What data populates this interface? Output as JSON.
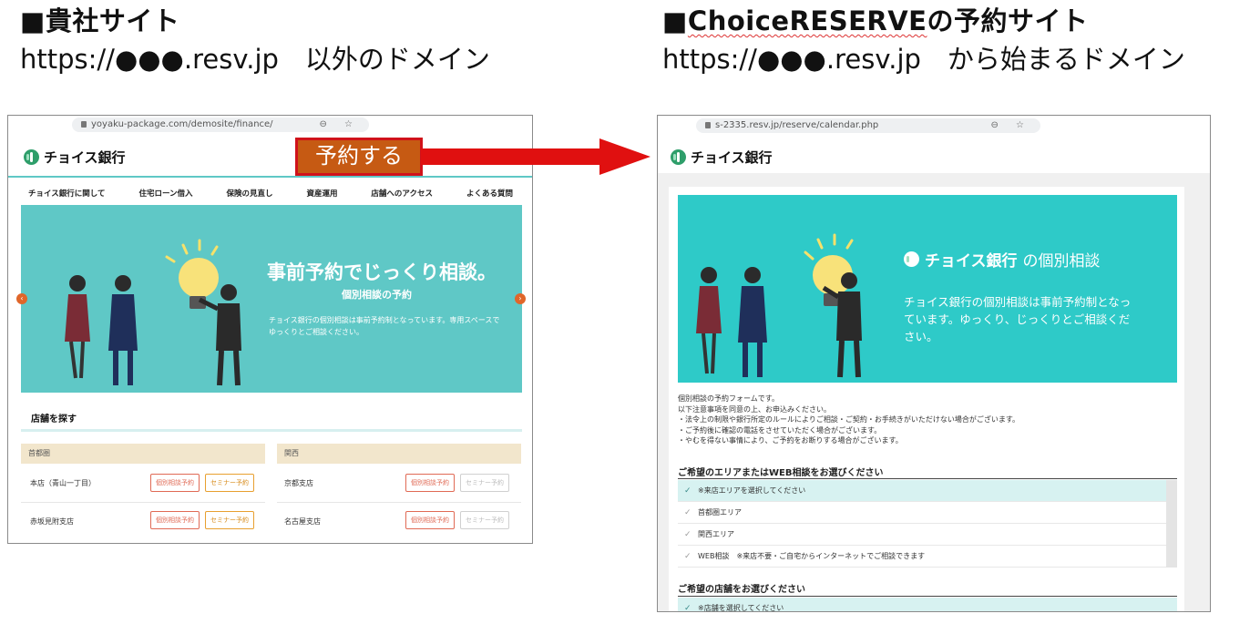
{
  "left": {
    "heading": "■貴社サイト",
    "url_caption": "https://●●●.resv.jp　以外のドメイン",
    "browser": {
      "address": "yoyaku-package.com/demosite/finance/",
      "tools": "⊖ ☆"
    },
    "logo_text": "チョイス銀行",
    "reserve_button": "予約する",
    "nav": [
      "チョイス銀行に関して",
      "住宅ローン借入",
      "保険の見直し",
      "資産運用",
      "店舗へのアクセス",
      "よくある質問"
    ],
    "hero": {
      "title": "事前予約でじっくり相談。",
      "subtitle": "個別相談の予約",
      "text": "チョイス銀行の個別相談は事前予約制となっています。専用スペースでゆっくりとご相談ください。"
    },
    "store_search": "店舗を探す",
    "regions": [
      {
        "name": "首都圏",
        "branches": [
          {
            "name": "本店（青山一丁目）",
            "reserve": "個別相談予約",
            "seminar": "セミナー予約",
            "seminar_disabled": false
          },
          {
            "name": "赤坂見附支店",
            "reserve": "個別相談予約",
            "seminar": "セミナー予約",
            "seminar_disabled": false
          }
        ]
      },
      {
        "name": "関西",
        "branches": [
          {
            "name": "京都支店",
            "reserve": "個別相談予約",
            "seminar": "セミナー予約",
            "seminar_disabled": true
          },
          {
            "name": "名古屋支店",
            "reserve": "個別相談予約",
            "seminar": "セミナー予約",
            "seminar_disabled": true
          }
        ]
      }
    ]
  },
  "right": {
    "heading_prefix": "■",
    "heading_brand": "ChoiceRESERVE",
    "heading_suffix": "の予約サイト",
    "url_caption": "https://●●●.resv.jp　から始まるドメイン",
    "browser": {
      "address": "s-2335.resv.jp/reserve/calendar.php",
      "tools": "⊖ ☆"
    },
    "logo_text": "チョイス銀行",
    "hero": {
      "brand": "チョイス銀行",
      "title_suffix": "の個別相談",
      "text": "チョイス銀行の個別相談は事前予約制となっています。ゆっくり、じっくりとご相談ください。"
    },
    "notes": [
      "個別相談の予約フォームです。",
      "以下注意事項を同意の上、お申込みください。",
      "・法令上の制限や銀行所定のルールによりご相談・ご契約・お手続きがいただけない場合がございます。",
      "・ご予約後に確認の電話をさせていただく場合がございます。",
      "・やむを得ない事情により、ご予約をお断りする場合がございます。"
    ],
    "area_section": "ご希望のエリアまたはWEB相談をお選びください",
    "area_options": [
      "※来店エリアを選択してください",
      "首都圏エリア",
      "関西エリア",
      "WEB相談　※来店不要・ご自宅からインターネットでご相談できます"
    ],
    "store_section": "ご希望の店舗をお選びください",
    "store_options": [
      "※店舗を選択してください"
    ]
  },
  "colors": {
    "teal": "#5fc8c6",
    "teal_dark": "#2ecac8",
    "arrow": "#e01010",
    "reserve_btn": "#c65a13"
  }
}
